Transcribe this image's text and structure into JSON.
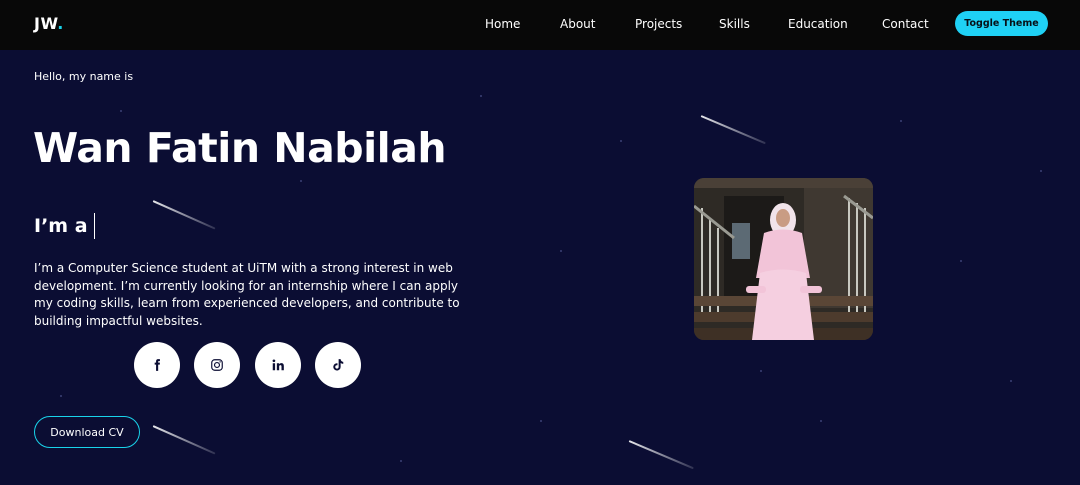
{
  "nav": {
    "logo_text": "JW",
    "logo_dot": ".",
    "links": [
      "Home",
      "About",
      "Projects",
      "Skills",
      "Education",
      "Contact"
    ],
    "toggle_label": "Toggle Theme"
  },
  "hero": {
    "greeting": "Hello, my name is",
    "name": "Wan Fatin Nabilah",
    "role_prefix": "I’m a",
    "bio": "I’m a Computer Science student at UiTM with a strong interest in web development. I’m currently looking for an internship where I can apply my coding skills, learn from experienced developers, and contribute to building impactful websites.",
    "cv_label": "Download CV"
  },
  "socials": [
    "facebook-icon",
    "instagram-icon",
    "linkedin-icon",
    "tiktok-icon"
  ],
  "colors": {
    "background": "#0b0d33",
    "navbar": "#080808",
    "accent": "#19d3ea",
    "toggle_button": "#1fd1f5"
  }
}
